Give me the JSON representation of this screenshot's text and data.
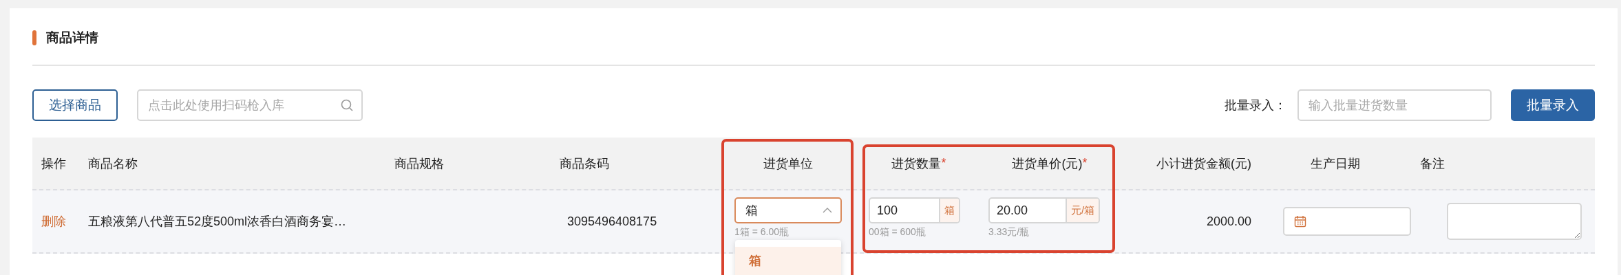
{
  "section_title": "商品详情",
  "toolbar": {
    "select_button": "选择商品",
    "scan_search": {
      "placeholder": "点击此处使用扫码枪入库"
    },
    "batch_label": "批量录入：",
    "batch_input": {
      "placeholder": "输入批量进货数量"
    },
    "batch_button": "批量录入"
  },
  "table": {
    "columns": [
      {
        "label": "操作"
      },
      {
        "label": "商品名称"
      },
      {
        "label": "商品规格"
      },
      {
        "label": "商品条码"
      },
      {
        "label": "进货单位"
      },
      {
        "label": "进货数量",
        "required_mark": "*"
      },
      {
        "label": "进货单价(元)",
        "required_mark": "*"
      },
      {
        "label": "小计进货金额(元)"
      },
      {
        "label": "生产日期"
      },
      {
        "label": "备注"
      }
    ],
    "rows": [
      {
        "action": "删除",
        "name": "五粮液第八代普五52度500ml浓香白酒商务宴…",
        "barcode": "3095496408175",
        "unit": {
          "value": "箱",
          "expanded": true,
          "hint": "1箱 = 6.00瓶",
          "options": [
            {
              "label": "箱",
              "selected": true
            }
          ]
        },
        "quantity": {
          "value": "100",
          "unit": "箱",
          "hint": "00箱 = 600瓶"
        },
        "price": {
          "value": "20.00",
          "unit": "元/箱",
          "hint": "3.33元/瓶"
        },
        "subtotal": "2000.00"
      }
    ]
  }
}
